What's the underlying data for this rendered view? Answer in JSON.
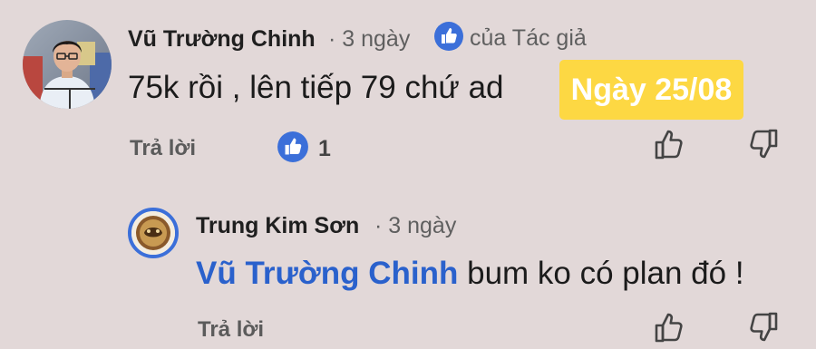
{
  "comment": {
    "author": "Vũ Trường Chinh",
    "time": "· 3 ngày",
    "author_liked_label": "của Tác giả",
    "text": "75k rồi , lên tiếp 79 chứ ad",
    "reply_label": "Trả lời",
    "like_count": "1"
  },
  "badge": {
    "date_label": "Ngày 25/08"
  },
  "reply": {
    "author": "Trung Kim Sơn",
    "time": "· 3 ngày",
    "mention": "Vũ Trường Chinh",
    "text": " bum ko có plan đó !",
    "reply_label": "Trả lời"
  },
  "colors": {
    "background": "#e2d8d8",
    "like_blue": "#3b6fd9",
    "mention_blue": "#2a61cc",
    "badge_yellow": "#fdd843"
  },
  "icons": {
    "like_badge": "thumbs-up-icon",
    "like_button": "thumbs-up-outline-icon",
    "dislike_button": "thumbs-down-outline-icon"
  }
}
